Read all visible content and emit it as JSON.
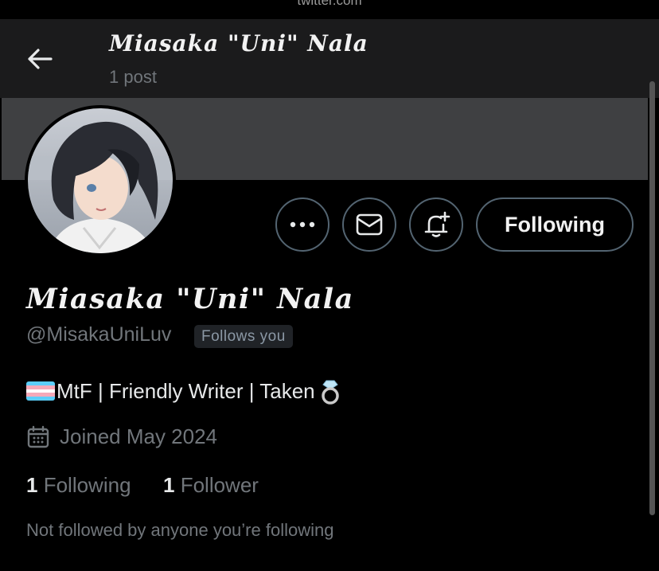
{
  "browser": {
    "url": "twitter.com"
  },
  "header": {
    "name": "Miasaka \"Uni\" Nala",
    "posts": "1 post"
  },
  "profile": {
    "display_name": "Miasaka \"Uni\" Nala",
    "handle": "@MisakaUniLuv",
    "follows_you": "Follows you",
    "bio": "MtF | Friendly Writer | Taken",
    "joined": "Joined May 2024",
    "following_count": "1",
    "following_label": "Following",
    "followers_count": "1",
    "followers_label": "Follower",
    "mutuals_note": "Not followed by anyone you’re following"
  },
  "actions": {
    "follow_state": "Following"
  },
  "icons": [
    "back-arrow-icon",
    "more-icon",
    "message-icon",
    "notification-bell-icon",
    "calendar-icon",
    "trans-flag-emoji",
    "ring-emoji"
  ],
  "colors": {
    "background": "#000000",
    "header_bg": "#1b1b1c",
    "banner": "#3f4042",
    "muted_text": "#71767b",
    "button_border": "#536471"
  }
}
